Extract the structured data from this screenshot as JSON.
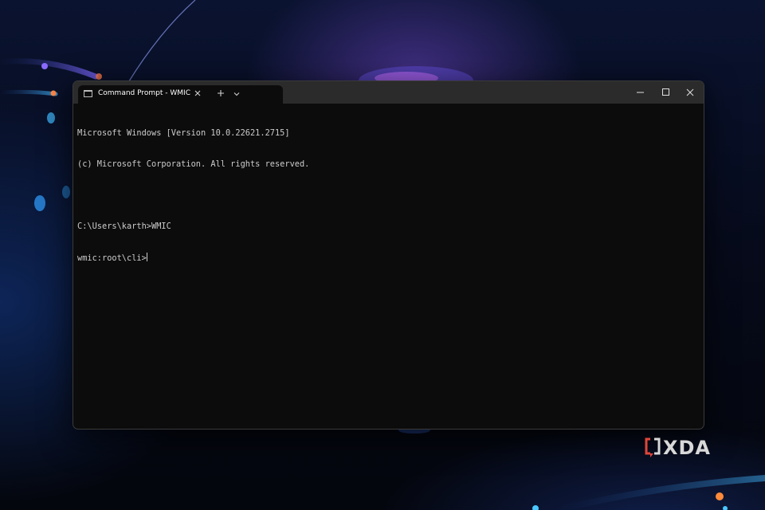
{
  "window": {
    "tab_title": "Command Prompt - WMIC",
    "tab_close_icon": "close-icon",
    "new_tab_label": "+",
    "dropdown_icon": "chevron-down-icon",
    "minimize_icon": "minimize-icon",
    "maximize_icon": "maximize-icon",
    "close_icon": "close-icon"
  },
  "terminal": {
    "lines": [
      "Microsoft Windows [Version 10.0.22621.2715]",
      "(c) Microsoft Corporation. All rights reserved.",
      "",
      "C:\\Users\\karth>WMIC",
      "wmic:root\\cli>"
    ]
  },
  "watermark": {
    "text": "XDA",
    "accent_color": "#e0463a"
  },
  "colors": {
    "terminal_bg": "#0c0c0c",
    "titlebar_bg": "#2b2b2b",
    "terminal_text": "#cccccc"
  }
}
